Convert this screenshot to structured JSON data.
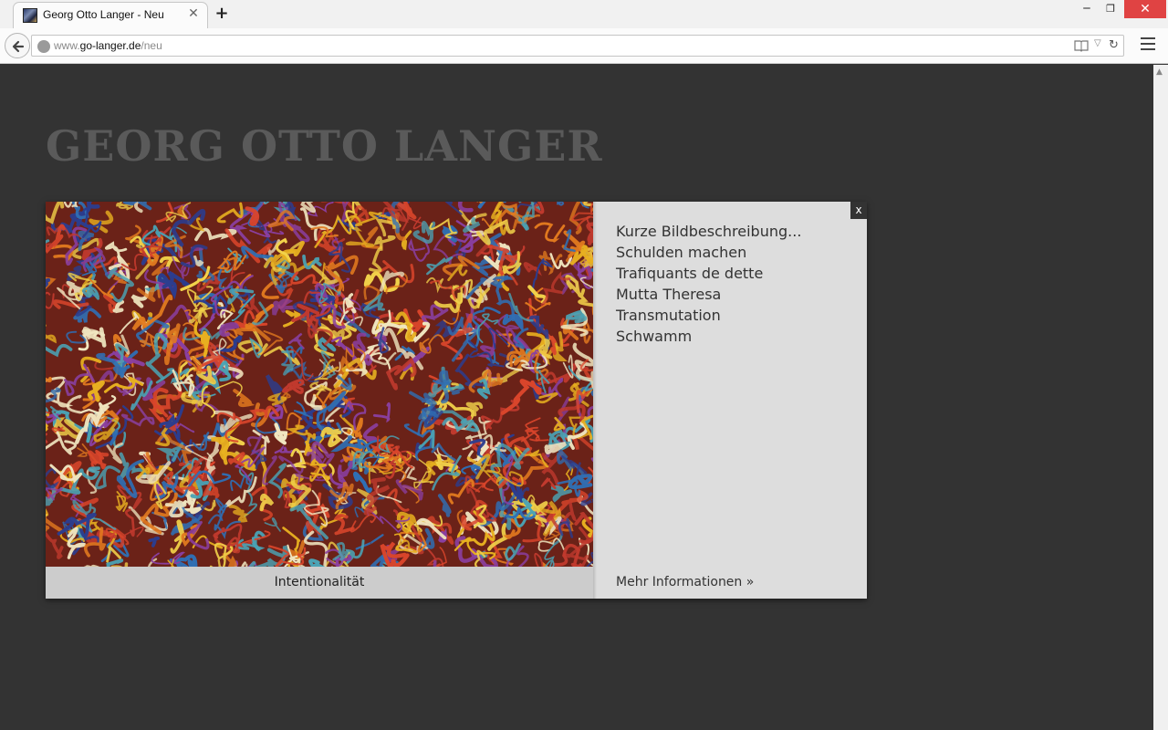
{
  "browser": {
    "tab_title": "Georg Otto Langer - Neu",
    "tab_close": "✕",
    "new_tab": "+",
    "url_prefix": "www.",
    "url_domain": "go-langer.de",
    "url_path": "/neu",
    "window_min": "‒",
    "window_restore": "❐",
    "window_close": "✕"
  },
  "site": {
    "title": "GEORG OTTO LANGER"
  },
  "gallery": {
    "caption": "Intentionalität",
    "close_label": "x",
    "links": [
      "Kurze Bildbeschreibung...",
      "Schulden machen",
      "Trafiquants de dette",
      "Mutta Theresa",
      "Transmutation",
      "Schwamm"
    ],
    "more_info": "Mehr Informationen »"
  },
  "colors": {
    "page_background": "#333333",
    "title_color": "#5a5a5a",
    "panel_background": "#dddddd",
    "caption_background": "#cccccc",
    "close_button": "#333333",
    "window_close": "#e04343"
  }
}
